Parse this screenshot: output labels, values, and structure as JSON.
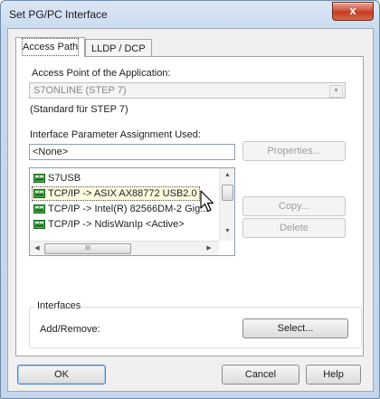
{
  "window": {
    "title": "Set PG/PC Interface",
    "close_symbol": "x"
  },
  "tabs": [
    {
      "label": "Access Path",
      "active": true
    },
    {
      "label": "LLDP / DCP",
      "active": false
    }
  ],
  "access_point": {
    "label": "Access Point of the Application:",
    "value": "S7ONLINE (STEP 7)",
    "description": "(Standard für STEP 7)"
  },
  "interface_assignment": {
    "label": "Interface Parameter Assignment Used:",
    "value": "<None>",
    "properties_label": "Properties...",
    "copy_label": "Copy...",
    "delete_label": "Delete",
    "items": [
      {
        "label": "S7USB",
        "icon": "network-adapter-icon"
      },
      {
        "label": "TCP/IP -> ASIX AX88772 USB2.0",
        "icon": "network-adapter-icon",
        "selected": true
      },
      {
        "label": "TCP/IP -> Intel(R) 82566DM-2 Gig...",
        "icon": "network-adapter-icon"
      },
      {
        "label": "TCP/IP -> NdisWanIp  <Active>",
        "icon": "network-adapter-icon"
      }
    ]
  },
  "interfaces_group": {
    "legend": "Interfaces",
    "label": "Add/Remove:",
    "select_label": "Select..."
  },
  "footer": {
    "ok_label": "OK",
    "cancel_label": "Cancel",
    "help_label": "Help"
  },
  "scroll_glyphs": {
    "up": "▲",
    "down": "▼",
    "left": "◀",
    "right": "▶",
    "grip": "III",
    "combo": "▼"
  },
  "colors": {
    "title_bg": "#c4d6ec",
    "close_red": "#c33b22",
    "selected_row": "#fffbe0",
    "icon_green": "#2e7d32"
  }
}
